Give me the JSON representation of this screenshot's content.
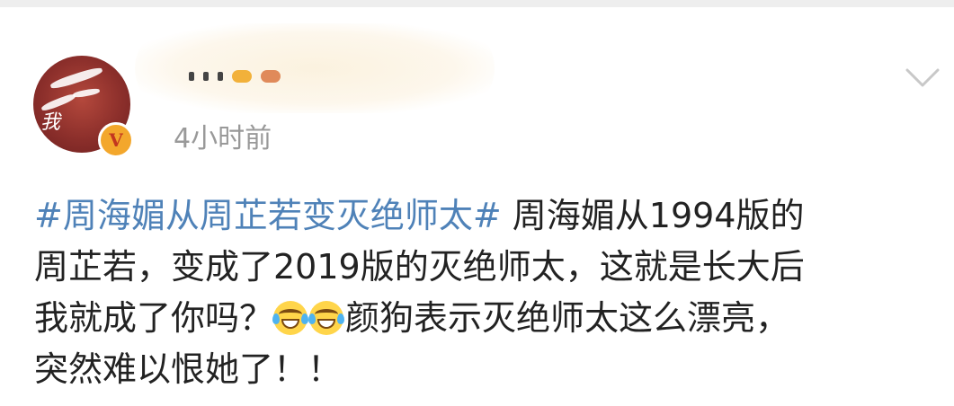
{
  "post": {
    "author_name": "",
    "timestamp": "4小时前",
    "avatar_text": "我",
    "badge_text": "V",
    "content": {
      "lines": [
        {
          "hashtag": "#周海媚从周芷若变灭绝师太#",
          "text": " 周海媚从1994版的"
        },
        {
          "text": "周芷若，变成了2019版的灭绝师太，这就是长大后"
        },
        {
          "text_before": "我就成了你吗？",
          "emojis": [
            "laughing-crying-emoji",
            "laughing-crying-emoji"
          ],
          "text_after": "颜狗表示灭绝师太这么漂亮，"
        },
        {
          "text": "突然难以恨她了！！"
        }
      ]
    }
  },
  "icons": {
    "menu": "chevron-down-icon",
    "verified": "verified-badge-icon",
    "emoji": "laughing-crying-emoji"
  },
  "colors": {
    "hashtag": "#4f82b8",
    "text": "#222222",
    "timestamp": "#999999",
    "badge": "#f3a72c",
    "avatar": "#8c2f2b",
    "chevron": "#c8c8c8"
  }
}
